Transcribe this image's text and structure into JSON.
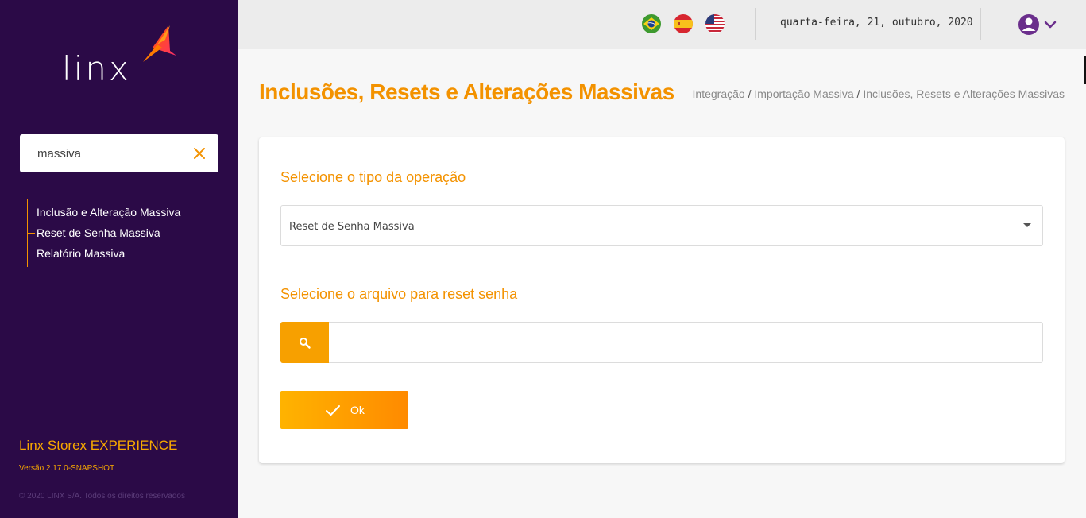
{
  "sidebar": {
    "logo_text": "linx",
    "search": {
      "value": "massiva",
      "placeholder": ""
    },
    "items": [
      {
        "label": "Inclusão e Alteração Massiva"
      },
      {
        "label": "Reset de Senha Massiva"
      },
      {
        "label": "Relatório Massiva"
      }
    ],
    "app_name": "Linx Storex EXPERIENCE",
    "version": "Versão 2.17.0-SNAPSHOT",
    "copyright": "© 2020 LINX S/A. Todos os direitos reservados"
  },
  "topbar": {
    "flags": [
      "brazil-flag-icon",
      "spain-flag-icon",
      "usa-flag-icon"
    ],
    "date": "quarta-feira, 21, outubro, 2020",
    "user_icon": "user-avatar-icon"
  },
  "page": {
    "title": "Inclusões, Resets e Alterações Massivas",
    "breadcrumb": [
      "Integração",
      "Importação Massiva",
      "Inclusões, Resets e Alterações Massivas"
    ],
    "breadcrumb_separator": "/"
  },
  "form": {
    "operation_label": "Selecione o tipo da operação",
    "operation_value": "Reset de Senha Massiva",
    "file_label": "Selecione o arquivo para reset senha",
    "file_value": "",
    "ok_label": "Ok"
  },
  "colors": {
    "sidebar_bg": "#2b0a47",
    "accent": "#f39200",
    "accent_light": "#f7a800"
  }
}
